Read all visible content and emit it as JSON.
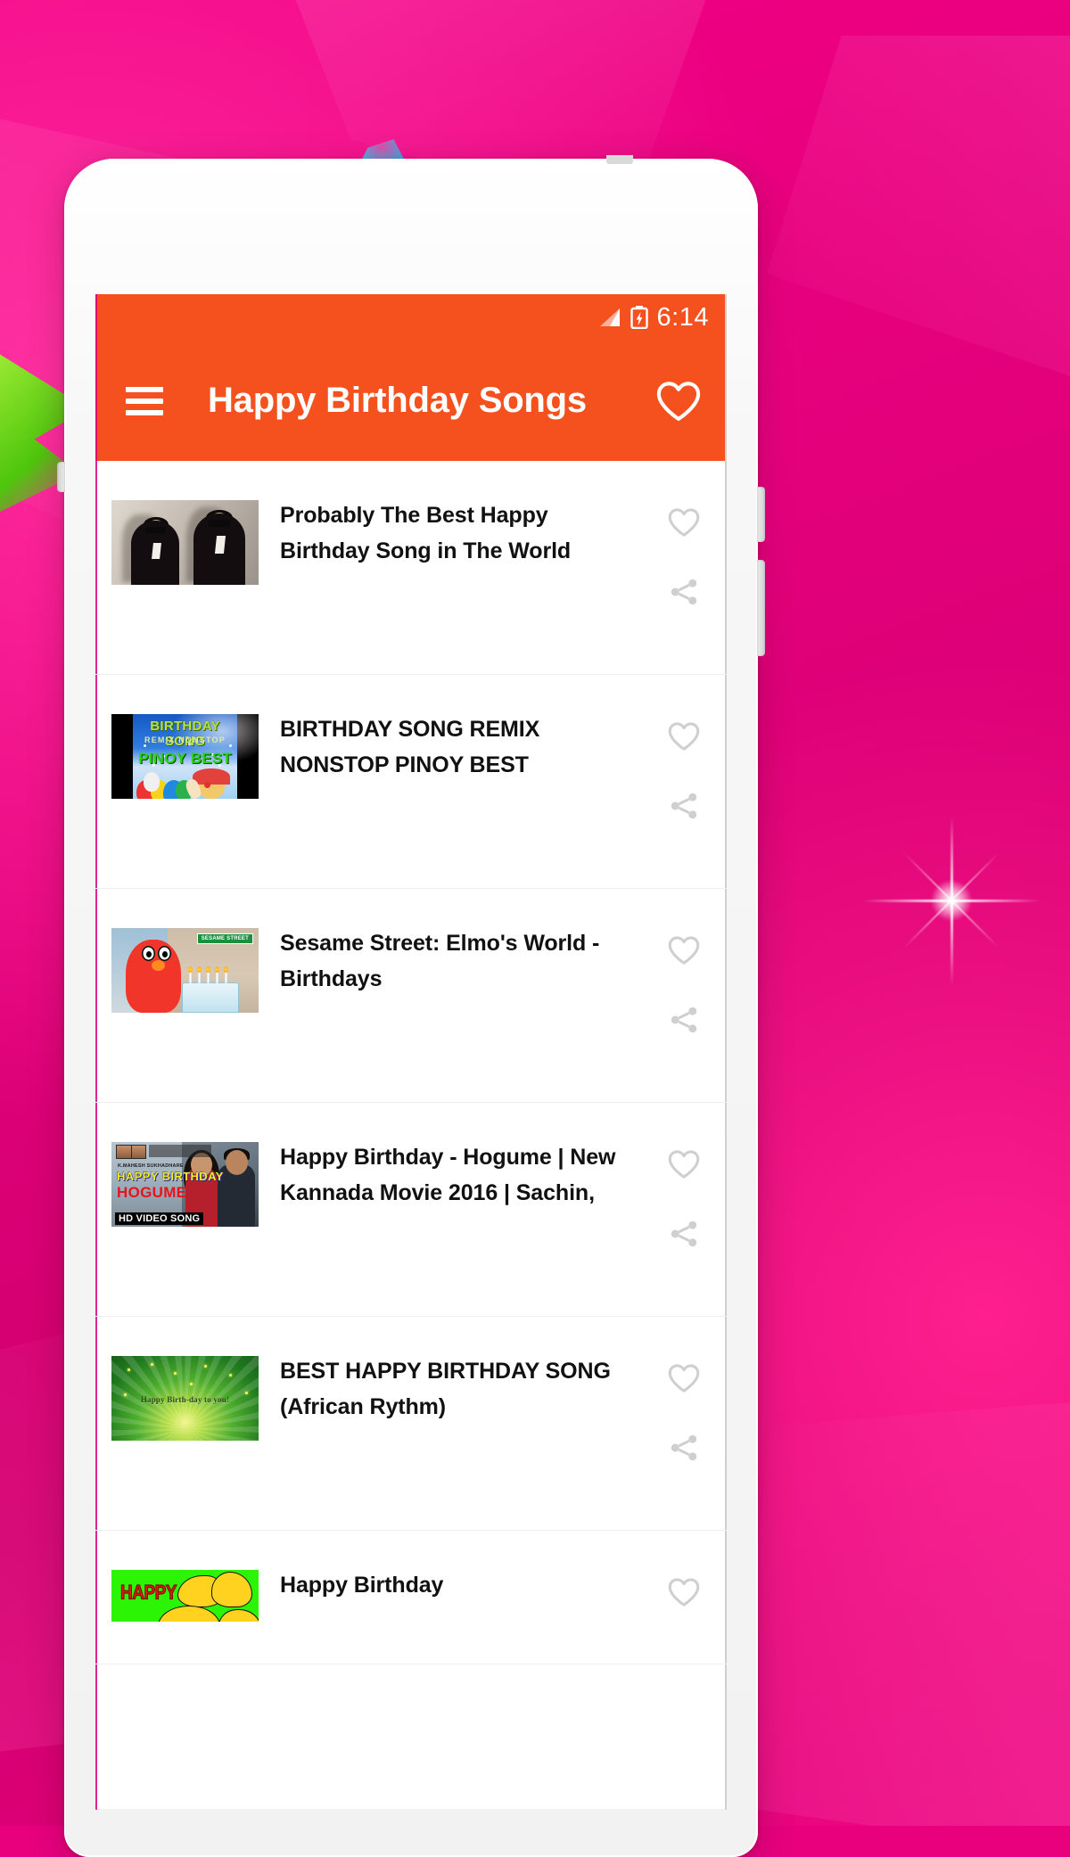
{
  "app": {
    "status_bar": {
      "signal_icon": "signal-bars-icon",
      "battery_icon": "battery-charging-icon",
      "time": "6:14"
    },
    "app_bar": {
      "menu_icon": "hamburger-menu-icon",
      "title": "Happy Birthday Songs",
      "favorite_icon": "heart-outline-icon"
    },
    "accent_color": "#F4511E",
    "backdrop_color": "#E8007D",
    "list": {
      "row_favorite_icon": "heart-outline-icon",
      "row_share_icon": "share-icon",
      "items": [
        {
          "title": "Probably The Best Happy Birthday Song in The World",
          "thumb_name": "thumbnail-two-men-in-suits",
          "thumb_text": []
        },
        {
          "title": "BIRTHDAY SONG REMIX NONSTOP PINOY BEST",
          "thumb_name": "thumbnail-birthday-song-remix",
          "thumb_text": [
            "BIRTHDAY SONG",
            "REMIX  NONSTOP",
            "PINOY BEST"
          ]
        },
        {
          "title": "Sesame Street: Elmo's World - Birthdays",
          "thumb_name": "thumbnail-elmo-sesame-street",
          "thumb_text": [
            "SESAME STREET"
          ]
        },
        {
          "title": "Happy Birthday - Hogume | New Kannada Movie 2016 | Sachin,",
          "thumb_name": "thumbnail-hogume-kannada-movie",
          "thumb_text": [
            "K.MAHESH SUKHADHARE",
            "HAPPY  BIRTHDAY",
            "HOGUME",
            "HD VIDEO SONG"
          ]
        },
        {
          "title": "BEST HAPPY BIRTHDAY SONG (African Rythm)",
          "thumb_name": "thumbnail-green-sunburst",
          "thumb_text": [
            "Happy Birth-day to you!"
          ]
        },
        {
          "title": "Happy Birthday",
          "thumb_name": "thumbnail-happy-green-banner",
          "thumb_text": [
            "HAPPY"
          ]
        }
      ]
    }
  }
}
